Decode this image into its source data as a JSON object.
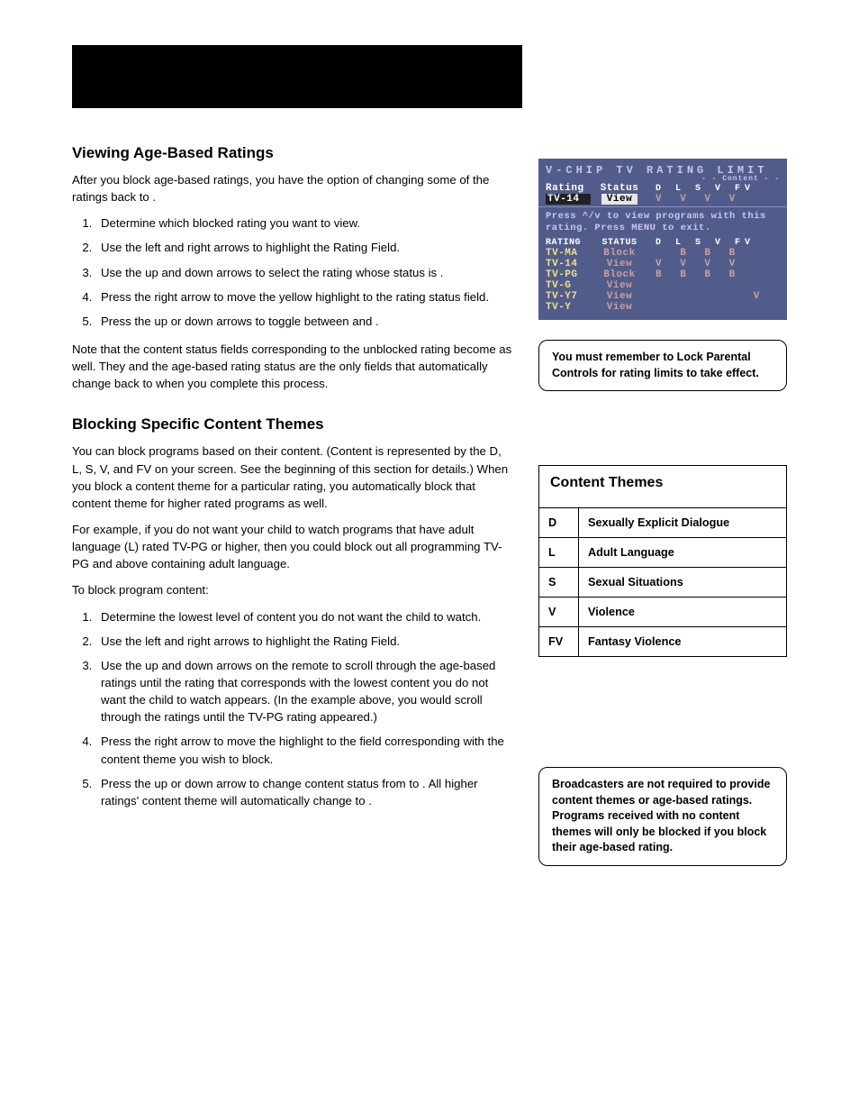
{
  "section1": {
    "heading": "Viewing Age-Based Ratings",
    "intro": "After you block age-based ratings, you have the option of changing some of the ratings back to        .",
    "steps": [
      "Determine which blocked rating you want to view.",
      "Use the left and right arrows to highlight the Rating Field.",
      "Use the up and down arrows to select the rating whose status is        .",
      "Press the right arrow to move the yellow highlight to the rating status field.",
      "Press the up or down arrows to toggle between          and        ."
    ],
    "note": "Note that the content status fields corresponding to the unblocked rating become         as well. They and the age-based rating status are the only fields that automatically change back to         when you complete this process."
  },
  "section2": {
    "heading": "Blocking Specific Content Themes",
    "p1": "You can block programs based on their content. (Content is represented by the D, L, S, V, and FV on your screen. See the beginning of this section for details.) When you block a content theme for a particular rating, you automatically block that content theme for higher rated programs as well.",
    "p2": "For example, if you do not want your child to watch programs that have adult language (L) rated TV-PG or higher, then you could block out all programming TV-PG and above containing adult language.",
    "p3": "To block program content:",
    "steps": [
      "Determine the lowest level of content you do not want the child to watch.",
      "Use the left and right arrows to highlight the Rating Field.",
      "Use the up and down arrows on the remote to scroll through the age-based ratings until the rating that corresponds with the lowest content you do not want the child to watch appears.  (In the example above, you would scroll through the ratings until the TV-PG rating appeared.)",
      "Press the right arrow to move the highlight to the field corresponding with the content theme you wish to block.",
      "Press the up or down arrow to change content status from    to   . All higher ratings' content theme will automatically change to   ."
    ]
  },
  "osd": {
    "title": "V-CHIP TV RATING LIMIT",
    "subtitle": "- - Content - -",
    "hdr_rating": "Rating",
    "hdr_status": "Status",
    "hdr_flags": "D L S V FV",
    "sel_rating": "TV-14",
    "sel_status": "View",
    "sel_flags": "V V V V",
    "instr": "Press ^/v to view programs with this rating. Press MENU to exit.",
    "list_hdr_rating": "RATING",
    "list_hdr_status": "STATUS",
    "list_hdr_flags": "D L S V FV",
    "rows": [
      {
        "r": "TV-MA",
        "s": "Block",
        "f": "  B B B"
      },
      {
        "r": "TV-14",
        "s": "View",
        "f": "V V V V"
      },
      {
        "r": "TV-PG",
        "s": "Block",
        "f": "B B B B"
      },
      {
        "r": "TV-G",
        "s": "View",
        "f": ""
      },
      {
        "r": "TV-Y7",
        "s": "View",
        "f": "        V"
      },
      {
        "r": "TV-Y",
        "s": "View",
        "f": ""
      }
    ]
  },
  "note1": "You must remember to Lock Parental Controls for rating limits to take effect.",
  "themes": {
    "title": "Content Themes",
    "rows": [
      {
        "k": "D",
        "v": "Sexually Explicit Dialogue"
      },
      {
        "k": "L",
        "v": "Adult Language"
      },
      {
        "k": "S",
        "v": "Sexual Situations"
      },
      {
        "k": "V",
        "v": "Violence"
      },
      {
        "k": "FV",
        "v": "Fantasy Violence"
      }
    ]
  },
  "note2": "Broadcasters are not required to provide content themes or age-based ratings. Programs received with no content themes will only be blocked if you block their age-based rating."
}
